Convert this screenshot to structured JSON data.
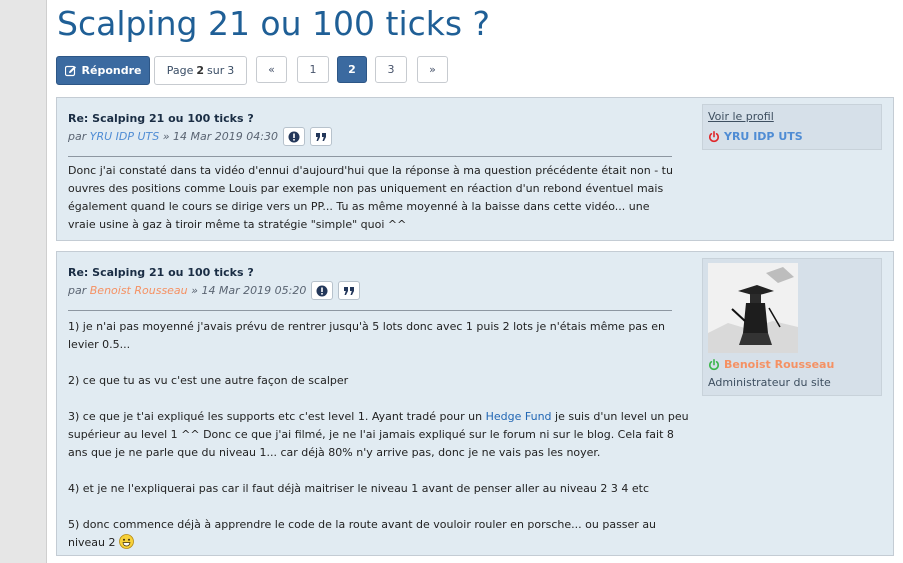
{
  "topic": {
    "title": "Scalping 21 ou 100 ticks ?"
  },
  "toolbar": {
    "reply_label": "Répondre"
  },
  "pagination": {
    "prefix": "Page",
    "current": "2",
    "middle": "sur",
    "total": "3",
    "prev_label": "«",
    "next_label": "»",
    "pages": [
      "1",
      "2",
      "3"
    ]
  },
  "posts": [
    {
      "subject": "Re: Scalping 21 ou 100 ticks ?",
      "by": "par",
      "author": "YRU IDP UTS",
      "date": "» 14 Mar 2019 04:30",
      "body": [
        "Donc j'ai constaté dans ta vidéo d'ennui d'aujourd'hui que la réponse à ma question précédente était non - tu ouvres des positions comme Louis par exemple non pas uniquement en réaction d'un rebond éventuel mais également quand le cours se dirige vers un PP... Tu as même moyenné à la baisse dans cette vidéo... une vraie usine à gaz à tiroir même ta stratégie \"simple\" quoi ^^"
      ],
      "profile": {
        "view_profile": "Voir le profil",
        "username": "YRU IDP UTS",
        "status_color": "#e0262a"
      }
    },
    {
      "subject": "Re: Scalping 21 ou 100 ticks ?",
      "by": "par",
      "author": "Benoist Rousseau",
      "date": "» 14 Mar 2019 05:20",
      "body": {
        "p1": "1) je n'ai pas moyenné j'avais prévu de rentrer jusqu'à 5 lots donc avec 1 puis 2 lots je n'étais même pas en levier 0.5...",
        "p2": "2) ce que tu as vu c'est une autre façon de scalper",
        "p3_before": "3) ce que je t'ai expliqué les supports etc c'est level 1. Ayant tradé pour un",
        "p3_link": "Hedge Fund",
        "p3_after": "je suis d'un level un peu supérieur au level 1 ^^ Donc ce que j'ai filmé, je ne l'ai jamais expliqué sur le forum ni sur le blog. Cela fait 8 ans que je ne parle que du niveau 1... car déjà 80% n'y arrive pas, donc je ne vais pas les noyer.",
        "p4": "4) et je ne l'expliquerai pas car il faut déjà maitriser le niveau 1 avant de penser aller au niveau 2 3 4 etc",
        "p5": "5) donc commence déjà à apprendre le code de la route avant de vouloir rouler en porsche... ou passer au niveau 2"
      },
      "profile": {
        "username": "Benoist Rousseau",
        "role": "Administrateur du site",
        "status_color": "#3cb54a"
      }
    }
  ],
  "icons": {
    "reply": "pencil-square-icon",
    "report": "exclamation-circle-icon",
    "quote": "quote-icon",
    "status": "power-icon",
    "smiley": "grinning-face-icon"
  },
  "colors": {
    "title": "#1f5f96",
    "primary_button": "#3b6aa0",
    "post_background": "#e1ebf2",
    "author_blue": "#4f8cd4",
    "author_orange": "#f59163"
  }
}
